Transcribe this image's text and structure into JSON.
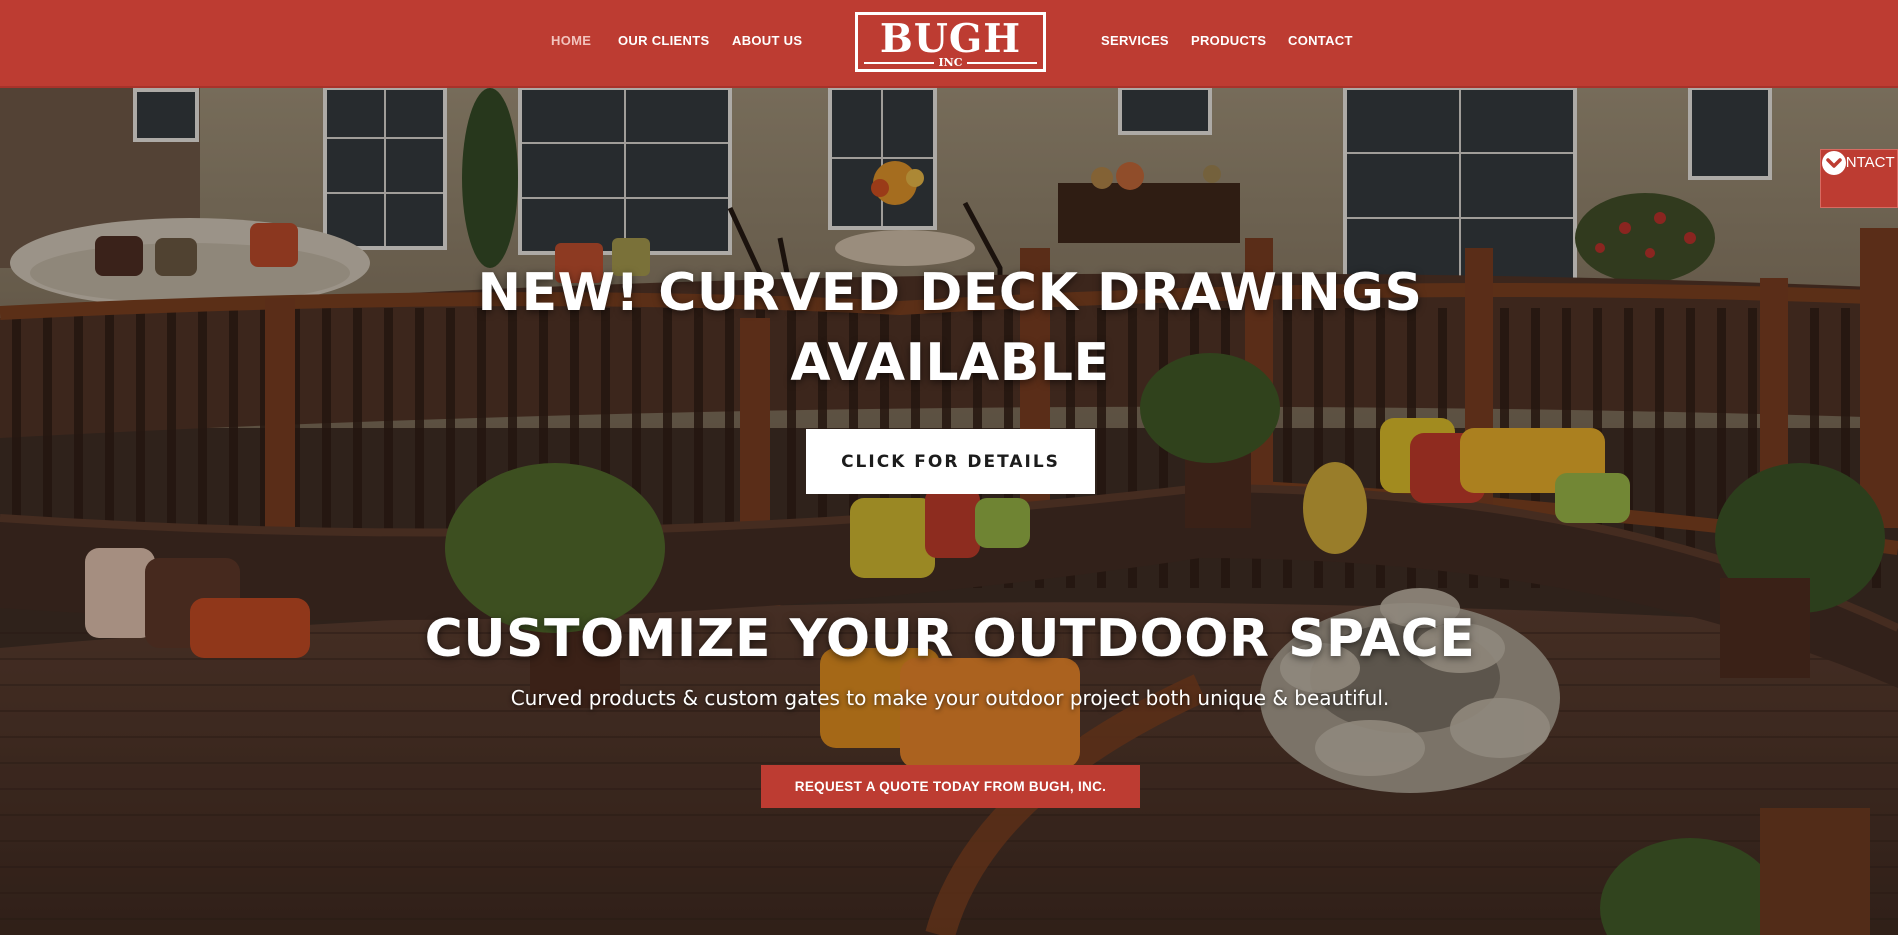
{
  "nav": {
    "left": [
      {
        "label": "HOME",
        "active": true
      },
      {
        "label": "OUR CLIENTS",
        "active": false
      },
      {
        "label": "ABOUT US",
        "active": false
      }
    ],
    "right": [
      {
        "label": "SERVICES",
        "active": false
      },
      {
        "label": "PRODUCTS",
        "active": false
      },
      {
        "label": "CONTACT",
        "active": false
      }
    ]
  },
  "logo": {
    "name": "BUGH",
    "suffix": "INC"
  },
  "hero": {
    "headline": "NEW! CURVED DECK DRAWINGS AVAILABLE",
    "details_button": "CLICK FOR DETAILS",
    "heading": "CUSTOMIZE YOUR OUTDOOR SPACE",
    "tagline": "Curved products & custom gates to make your outdoor project both unique & beautiful.",
    "quote_button": "REQUEST A QUOTE TODAY FROM BUGH, INC."
  },
  "side_contact": {
    "label": "CONTACT",
    "icon": "chevron-down-circle-icon"
  },
  "colors": {
    "brand": "#bd3c32",
    "white": "#ffffff"
  }
}
